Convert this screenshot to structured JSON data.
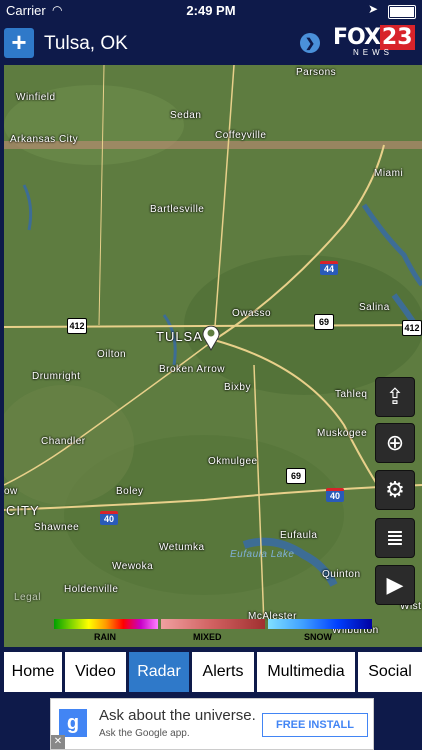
{
  "status_bar": {
    "carrier": "Carrier",
    "time": "2:49 PM"
  },
  "header": {
    "add_icon": "+",
    "city": "Tulsa, OK",
    "next_icon": "chevron-right",
    "logo": {
      "fox": "FOX",
      "channel": "23",
      "news": "NEWS"
    }
  },
  "map": {
    "cities": {
      "parsons": "Parsons",
      "winfield": "Winfield",
      "sedan": "Sedan",
      "arkansas_city": "Arkansas City",
      "coffeyville": "Coffeyville",
      "miami": "Miami",
      "bartlesville": "Bartlesville",
      "owasso": "Owasso",
      "tulsa": "TULSA",
      "salina": "Salina",
      "oilton": "Oilton",
      "drumright": "Drumright",
      "broken_arrow": "Broken Arrow",
      "bixby": "Bixby",
      "tahlequah": "Tahleq",
      "muskogee": "Muskogee",
      "chandler": "Chandler",
      "okmulgee": "Okmulgee",
      "boley": "Boley",
      "city": "CITY",
      "ow": "ow",
      "shawnee": "Shawnee",
      "eufaula": "Eufaula",
      "wetumka": "Wetumka",
      "wewoka": "Wewoka",
      "quinton": "Quinton",
      "holdenville": "Holdenville",
      "mcalester": "McAlester",
      "wilburton": "Wilburton",
      "wist": "Wist",
      "legal": "Legal"
    },
    "water": {
      "eufaula_lake": "Eufaula Lake"
    },
    "routes": {
      "i44": "44",
      "us412_w": "412",
      "us412_e": "412",
      "us69_n": "69",
      "us69_s": "69",
      "i40_w": "40",
      "i40_e": "40"
    },
    "controls": [
      "share-icon",
      "locate-icon",
      "settings-icon",
      "layers-icon",
      "play-icon"
    ]
  },
  "legend": {
    "rain": "RAIN",
    "mixed": "MIXED",
    "snow": "SNOW"
  },
  "tabs": [
    {
      "label": "Home"
    },
    {
      "label": "Video"
    },
    {
      "label": "Radar"
    },
    {
      "label": "Alerts"
    },
    {
      "label": "Multimedia"
    },
    {
      "label": "Social"
    }
  ],
  "ad": {
    "headline": "Ask about the universe.",
    "subline": "Ask the Google app.",
    "cta": "FREE INSTALL",
    "logo_letter": "g",
    "close": "✕"
  },
  "colors": {
    "nav": "#0e1a4a",
    "accent": "#2f79c9",
    "brand_red": "#d8232a",
    "map_green": "#5b7a3d"
  }
}
